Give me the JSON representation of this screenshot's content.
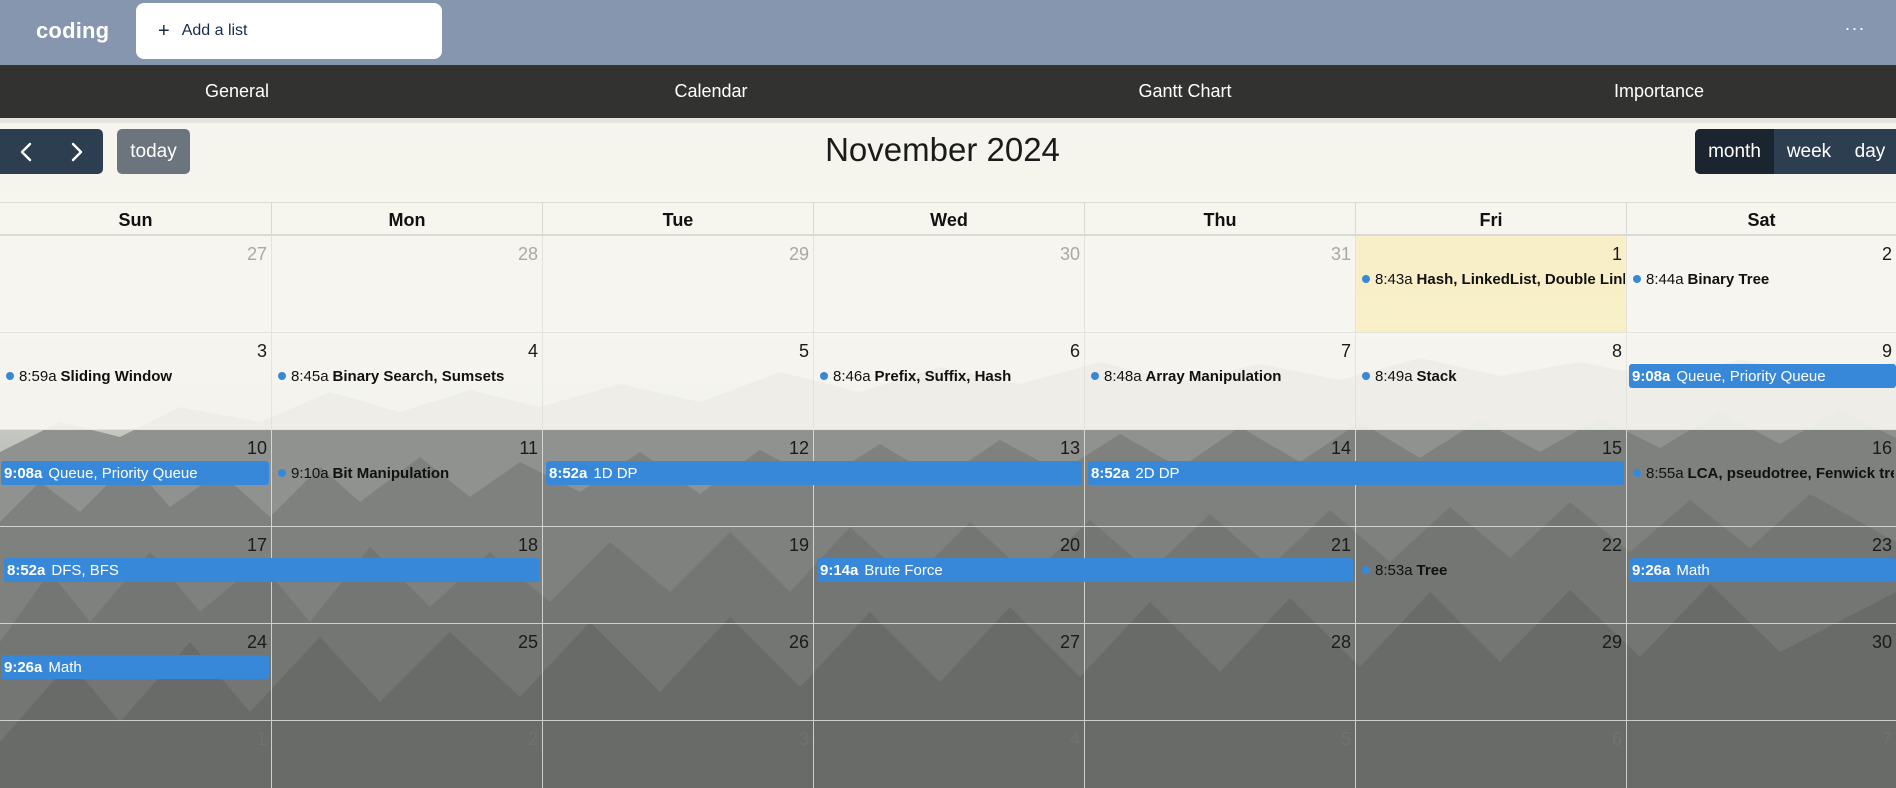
{
  "board": {
    "title": "coding",
    "add_list": "Add a list",
    "more": "···"
  },
  "icons": {
    "add": "plus-icon",
    "more": "more-horizontal-icon",
    "prev": "chevron-left-icon",
    "next": "chevron-right-icon"
  },
  "colors": {
    "header": "#8596ae",
    "nav": "#323230",
    "event": "#3788d8",
    "button": "#2c3e50",
    "today_button": "#6c757d",
    "today_cell": "#fbf1c8"
  },
  "tabs": [
    "General",
    "Calendar",
    "Gantt Chart",
    "Importance"
  ],
  "toolbar": {
    "today": "today",
    "title": "November 2024",
    "views": {
      "month": "month",
      "week": "week",
      "day": "day"
    },
    "active_view": "month"
  },
  "weekdays": [
    "Sun",
    "Mon",
    "Tue",
    "Wed",
    "Thu",
    "Fri",
    "Sat"
  ],
  "weeks": [
    [
      "27",
      "28",
      "29",
      "30",
      "31",
      "1",
      "2"
    ],
    [
      "3",
      "4",
      "5",
      "6",
      "7",
      "8",
      "9"
    ],
    [
      "10",
      "11",
      "12",
      "13",
      "14",
      "15",
      "16"
    ],
    [
      "17",
      "18",
      "19",
      "20",
      "21",
      "22",
      "23"
    ],
    [
      "24",
      "25",
      "26",
      "27",
      "28",
      "29",
      "30"
    ],
    [
      "1",
      "2",
      "3",
      "4",
      "5",
      "6",
      "7"
    ]
  ],
  "events": {
    "nov1": {
      "time": "8:43a",
      "title": "Hash, LinkedList, Double Linked List"
    },
    "nov2": {
      "time": "8:44a",
      "title": "Binary Tree"
    },
    "nov3": {
      "time": "8:59a",
      "title": "Sliding Window"
    },
    "nov4": {
      "time": "8:45a",
      "title": "Binary Search, Sumsets"
    },
    "nov6": {
      "time": "8:46a",
      "title": "Prefix, Suffix, Hash"
    },
    "nov7": {
      "time": "8:48a",
      "title": "Array Manipulation"
    },
    "nov8": {
      "time": "8:49a",
      "title": "Stack"
    },
    "nov9": {
      "time": "9:08a",
      "title": "Queue, Priority Queue"
    },
    "nov10": {
      "time": "9:08a",
      "title": "Queue, Priority Queue"
    },
    "nov11": {
      "time": "9:10a",
      "title": "Bit Manipulation"
    },
    "nov12": {
      "time": "8:52a",
      "title": "1D DP"
    },
    "nov14": {
      "time": "8:52a",
      "title": "2D DP"
    },
    "nov16": {
      "time": "8:55a",
      "title": "LCA, pseudotree, Fenwick tree"
    },
    "nov17": {
      "time": "8:52a",
      "title": "DFS, BFS"
    },
    "nov20": {
      "time": "9:14a",
      "title": "Brute Force"
    },
    "nov22": {
      "time": "8:53a",
      "title": "Tree"
    },
    "nov23": {
      "time": "9:26a",
      "title": "Math"
    },
    "nov24": {
      "time": "9:26a",
      "title": "Math"
    }
  }
}
